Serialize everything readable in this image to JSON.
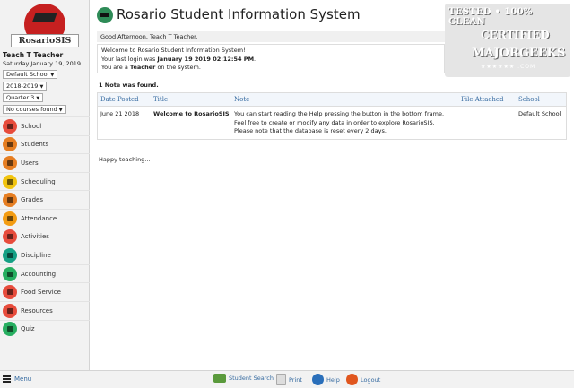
{
  "app": {
    "title": "Rosario Student Information System",
    "logo_text": "RosarioSIS"
  },
  "user": {
    "name": "Teach T Teacher",
    "date": "Saturday January 19, 2019"
  },
  "selectors": {
    "school": "Default School",
    "year": "2018-2019",
    "quarter": "Quarter 3",
    "courses": "No courses found"
  },
  "menu": [
    {
      "label": "School",
      "color": "#e74c3c"
    },
    {
      "label": "Students",
      "color": "#e67e22"
    },
    {
      "label": "Users",
      "color": "#e67e22"
    },
    {
      "label": "Scheduling",
      "color": "#f1c40f"
    },
    {
      "label": "Grades",
      "color": "#e67e22"
    },
    {
      "label": "Attendance",
      "color": "#f39c12"
    },
    {
      "label": "Activities",
      "color": "#e74c3c"
    },
    {
      "label": "Discipline",
      "color": "#16a085"
    },
    {
      "label": "Accounting",
      "color": "#27ae60"
    },
    {
      "label": "Food Service",
      "color": "#e74c3c"
    },
    {
      "label": "Resources",
      "color": "#e74c3c"
    },
    {
      "label": "Quiz",
      "color": "#27ae60"
    }
  ],
  "welcome": {
    "greeting": "Good Afternoon, Teach T Teacher.",
    "line1": "Welcome to Rosario Student Information System!",
    "line2_prefix": "Your last login was ",
    "line2_value": "January 19 2019 02:12:54 PM",
    "line2_suffix": ".",
    "line3_prefix": "You are a ",
    "line3_role": "Teacher",
    "line3_suffix": " on the system."
  },
  "notes": {
    "found": "1 Note was found.",
    "columns": [
      "Date Posted",
      "Title",
      "Note",
      "File Attached",
      "School"
    ],
    "rows": [
      {
        "date": "June 21 2018",
        "title": "Welcome to RosarioSIS",
        "note_lines": [
          "You can start reading the Help pressing the button in the bottom frame.",
          "Feel free to create or modify any data in order to explore RosarioSIS.",
          "Please note that the database is reset every 2 days."
        ],
        "file": "",
        "school": "Default School"
      }
    ]
  },
  "happy": "Happy teaching...",
  "badge": {
    "line1": "TESTED • 100% CLEAN",
    "line2": "CERTIFIED",
    "line3": "MAJORGEEKS",
    "line4": "★★★★★★ .COM"
  },
  "footer": {
    "menu": "Menu",
    "student_search": "Student Search",
    "print": "Print",
    "help": "Help",
    "logout": "Logout"
  },
  "colors": {
    "accent": "#356aa0",
    "logo_red": "#c62020"
  }
}
